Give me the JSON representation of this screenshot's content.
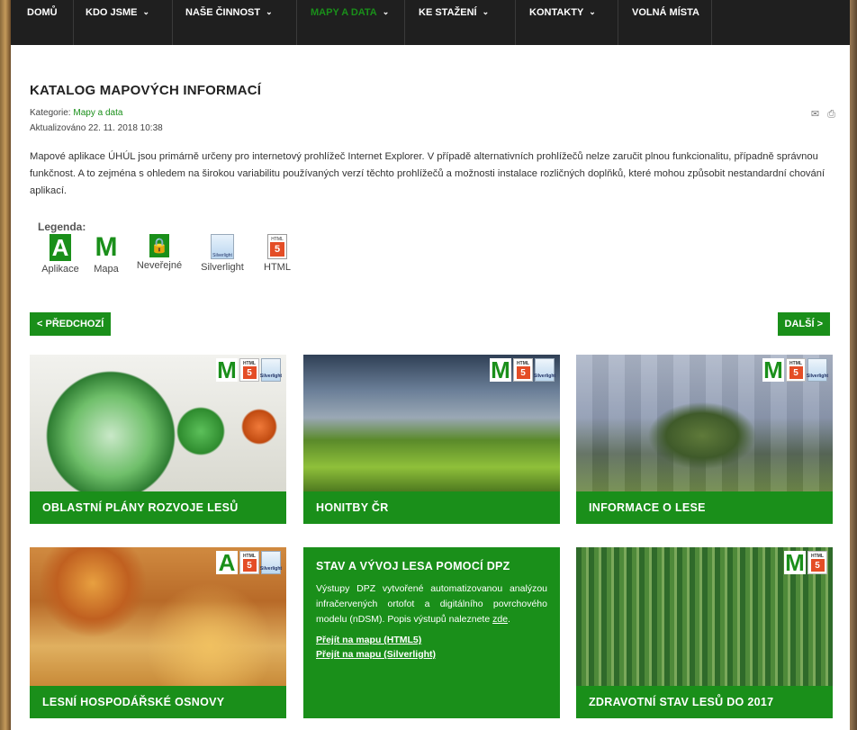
{
  "nav": {
    "items": [
      {
        "label": "DOMŮ",
        "chevron": false
      },
      {
        "label": "KDO JSME",
        "chevron": true
      },
      {
        "label": "NAŠE ČINNOST",
        "chevron": true
      },
      {
        "label": "MAPY A DATA",
        "chevron": true,
        "active": true
      },
      {
        "label": "KE STAŽENÍ",
        "chevron": true
      },
      {
        "label": "KONTAKTY",
        "chevron": true
      },
      {
        "label": "VOLNÁ MÍSTA",
        "chevron": false
      }
    ]
  },
  "page": {
    "title": "KATALOG MAPOVÝCH INFORMACÍ",
    "category_prefix": "Kategorie: ",
    "category": "Mapy a data",
    "updated": "Aktualizováno 22. 11. 2018 10:38",
    "intro": "Mapové aplikace ÚHÚL jsou primárně určeny pro internetový prohlížeč Internet Explorer. V případě alternativních prohlížečů nelze zaručit plnou funkcionalitu, případně správnou funkčnost. A to zejména s ohledem na širokou variabilitu používaných verzí těchto prohlížečů a možnosti instalace rozličných doplňků, které mohou způsobit nestandardní chování aplikací."
  },
  "legend": {
    "title": "Legenda:",
    "items": [
      {
        "icon": "A",
        "label": "Aplikace"
      },
      {
        "icon": "M",
        "label": "Mapa"
      },
      {
        "icon": "lock-icon",
        "label": "Neveřejné"
      },
      {
        "icon": "silverlight-icon",
        "label": "Silverlight"
      },
      {
        "icon": "html5-icon",
        "label": "HTML"
      }
    ]
  },
  "pager": {
    "prev": "< PŘEDCHOZÍ",
    "next": "DALŠÍ >"
  },
  "cards": [
    {
      "title": "OBLASTNÍ PLÁNY ROZVOJE LESŮ"
    },
    {
      "title": "HONITBY ČR"
    },
    {
      "title": "INFORMACE O LESE"
    },
    {
      "title": "LESNÍ HOSPODÁŘSKÉ OSNOVY"
    },
    {
      "title": "ZDRAVOTNÍ STAV LESŮ DO 2017"
    }
  ],
  "dpz": {
    "title": "STAV A VÝVOJ LESA POMOCÍ DPZ",
    "text": "Výstupy DPZ vytvořené automatizovanou analýzou infračervených ortofot a digitálního povrchového modelu (nDSM). Popis výstupů naleznete ",
    "link_zde": "zde",
    "text_end": ".",
    "link_html5": "Přejít na mapu (HTML5)",
    "link_silverlight": "Přejít na mapu (Silverlight)"
  },
  "badges": {
    "html": "HTML",
    "five": "5",
    "silverlight": "Silverlight",
    "M": "M",
    "A": "A"
  },
  "icons": {
    "mail": "✉",
    "print": "⎙",
    "lock": "🔒"
  },
  "colors": {
    "accent": "#1a8f1a",
    "navbar": "#1f1f1f"
  }
}
